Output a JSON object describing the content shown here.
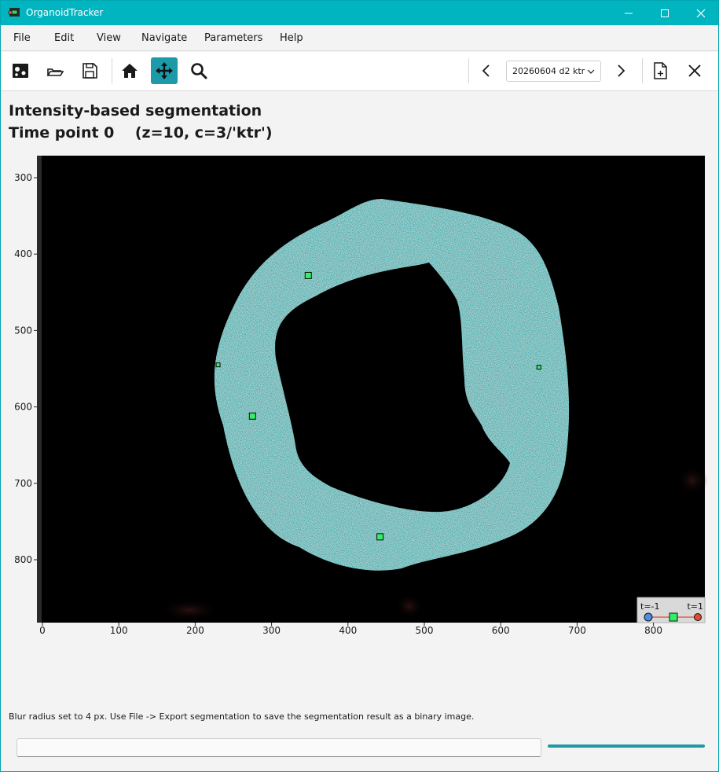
{
  "window": {
    "title": "OrganoidTracker",
    "accent": "#00b4c0"
  },
  "menu": {
    "items": [
      "File",
      "Edit",
      "View",
      "Navigate",
      "Parameters",
      "Help"
    ]
  },
  "toolbar": {
    "buttons": [
      {
        "name": "new-project-icon",
        "active": false
      },
      {
        "name": "open-folder-icon",
        "active": false
      },
      {
        "name": "save-icon",
        "active": false
      },
      {
        "name": "home-icon",
        "active": false
      },
      {
        "name": "move-icon",
        "active": true
      },
      {
        "name": "zoom-icon",
        "active": false
      },
      {
        "name": "previous-icon",
        "active": false
      },
      {
        "name": "next-icon",
        "active": false
      },
      {
        "name": "new-tab-icon",
        "active": false
      },
      {
        "name": "close-icon",
        "active": false
      }
    ],
    "experiment_selected": "20260604 d2 ktr"
  },
  "plot": {
    "title_line1": "Intensity-based segmentation",
    "title_line2": "Time point 0    (z=10, c=3/'ktr')",
    "x_ticks": [
      "0",
      "100",
      "200",
      "300",
      "400",
      "500",
      "600",
      "700",
      "800"
    ],
    "y_ticks": [
      "300",
      "400",
      "500",
      "600",
      "700",
      "800"
    ],
    "segmentation_color": "#1aa6a6",
    "marker_color": "#33ee66",
    "markers": [
      {
        "x": 348,
        "y": 428,
        "size": "large"
      },
      {
        "x": 230,
        "y": 545,
        "size": "small"
      },
      {
        "x": 275,
        "y": 612,
        "size": "large"
      },
      {
        "x": 650,
        "y": 548,
        "size": "small"
      },
      {
        "x": 442,
        "y": 770,
        "size": "large"
      }
    ],
    "legend": {
      "left_label": "t=-1",
      "right_label": "t=1",
      "left_color": "#4a90e2",
      "right_color": "#e24a3a",
      "mid_color": "#33ee66"
    }
  },
  "status": {
    "message": "Blur radius set to 4 px. Use File -> Export segmentation to save the segmentation result as a binary image."
  }
}
